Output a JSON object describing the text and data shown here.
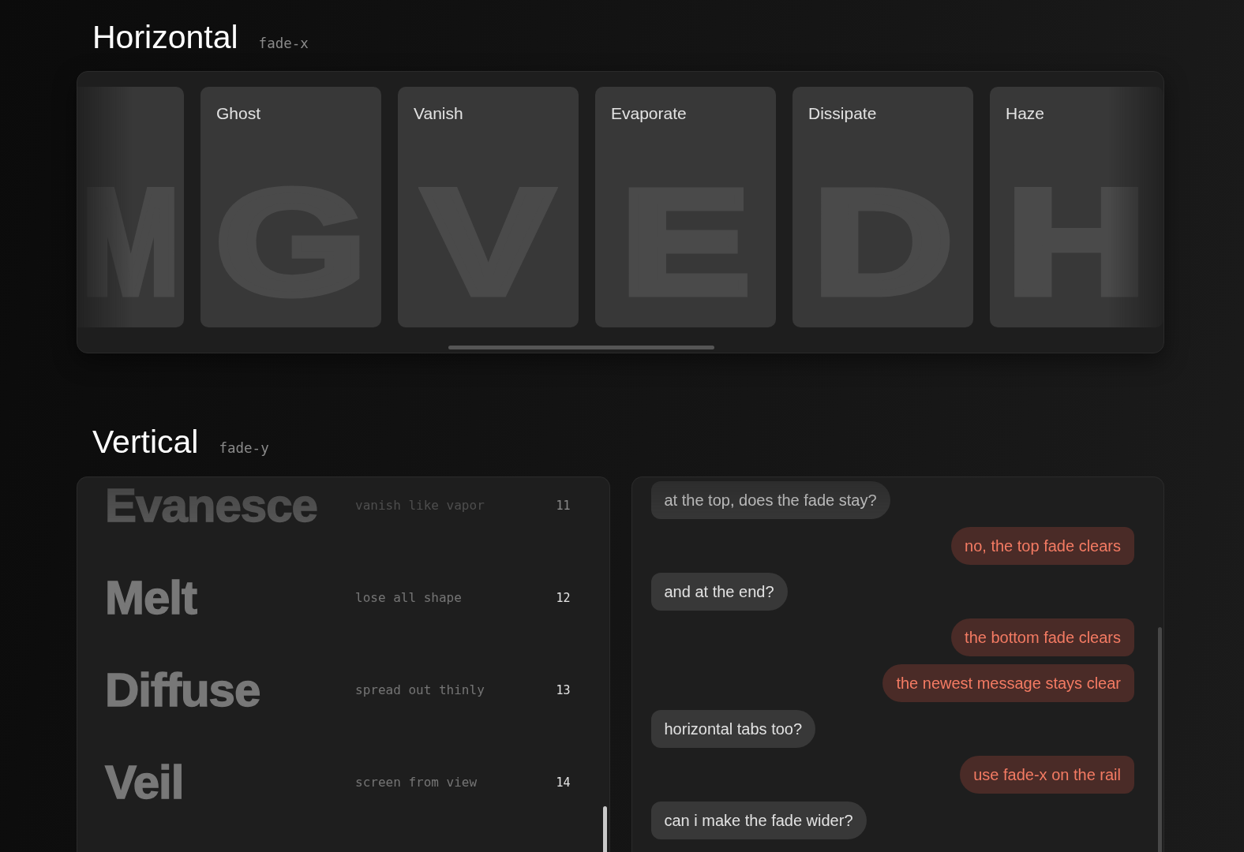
{
  "horizontal": {
    "title": "Horizontal",
    "tag": "fade-x",
    "cards": [
      {
        "kind": "edge",
        "glyph": "M"
      },
      {
        "kind": "full",
        "title": "Ghost",
        "glyph": "G"
      },
      {
        "kind": "full",
        "title": "Vanish",
        "glyph": "V"
      },
      {
        "kind": "full",
        "title": "Evaporate",
        "glyph": "E"
      },
      {
        "kind": "full",
        "title": "Dissipate",
        "glyph": "D"
      },
      {
        "kind": "full",
        "title": "Haze",
        "glyph": "H"
      }
    ]
  },
  "vertical": {
    "title": "Vertical",
    "tag": "fade-y",
    "list": [
      {
        "word": "Evanesce",
        "note": "vanish like vapor",
        "number": "11"
      },
      {
        "word": "Melt",
        "note": "lose all shape",
        "number": "12"
      },
      {
        "word": "Diffuse",
        "note": "spread out thinly",
        "number": "13"
      },
      {
        "word": "Veil",
        "note": "screen from view",
        "number": "14"
      }
    ],
    "chat": [
      {
        "kind": "received",
        "text": "at the top, does the fade stay?"
      },
      {
        "kind": "sent",
        "text": "no, the top fade clears"
      },
      {
        "kind": "received",
        "text": "and at the end?"
      },
      {
        "kind": "sent",
        "text": "the bottom fade clears"
      },
      {
        "kind": "sent",
        "text": "the newest message stays clear"
      },
      {
        "kind": "received",
        "text": "horizontal tabs too?"
      },
      {
        "kind": "sent",
        "text": "use fade-x on the rail"
      },
      {
        "kind": "received",
        "text": "can i make the fade wider?"
      }
    ]
  }
}
